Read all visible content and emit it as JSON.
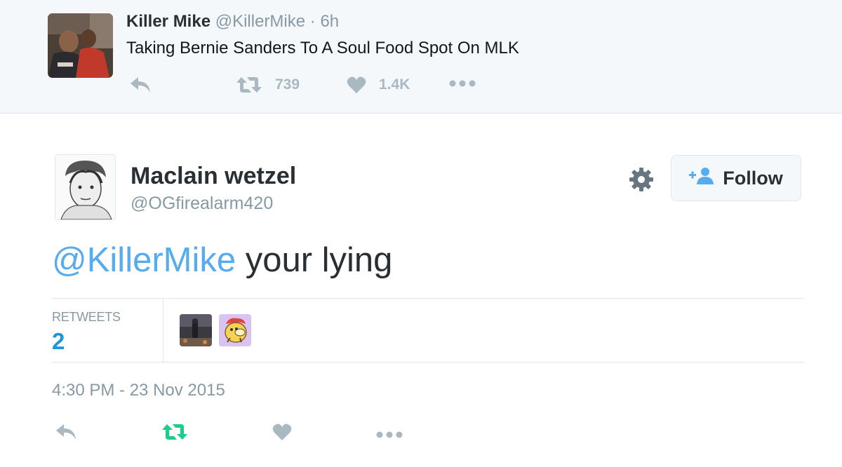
{
  "quoted_tweet": {
    "name": "Killer Mike",
    "handle": "@KillerMike",
    "separator": "·",
    "time": "6h",
    "text": "Taking Bernie Sanders To A Soul Food Spot On MLK",
    "retweet_count": "739",
    "like_count": "1.4K",
    "icons": [
      "reply-icon",
      "retweet-icon",
      "heart-icon",
      "more-icon"
    ]
  },
  "tweet": {
    "author_name": "Maclain wetzel",
    "author_handle": "@OGfirealarm420",
    "follow_label": "Follow",
    "text_mention": "@KillerMike",
    "text_body": " your lying",
    "stats": {
      "retweets_label": "RETWEETS",
      "retweets_count": "2"
    },
    "timestamp": "4:30 PM - 23 Nov 2015",
    "icons": [
      "reply-icon",
      "retweet-icon",
      "heart-icon",
      "more-icon"
    ]
  },
  "colors": {
    "accent": "#55acee",
    "count_blue": "#1b95e0",
    "muted": "#8899a6",
    "icon_gray": "#aab8c2",
    "retweet_green": "#19cf86",
    "quoted_bg": "#f5f8fa"
  }
}
